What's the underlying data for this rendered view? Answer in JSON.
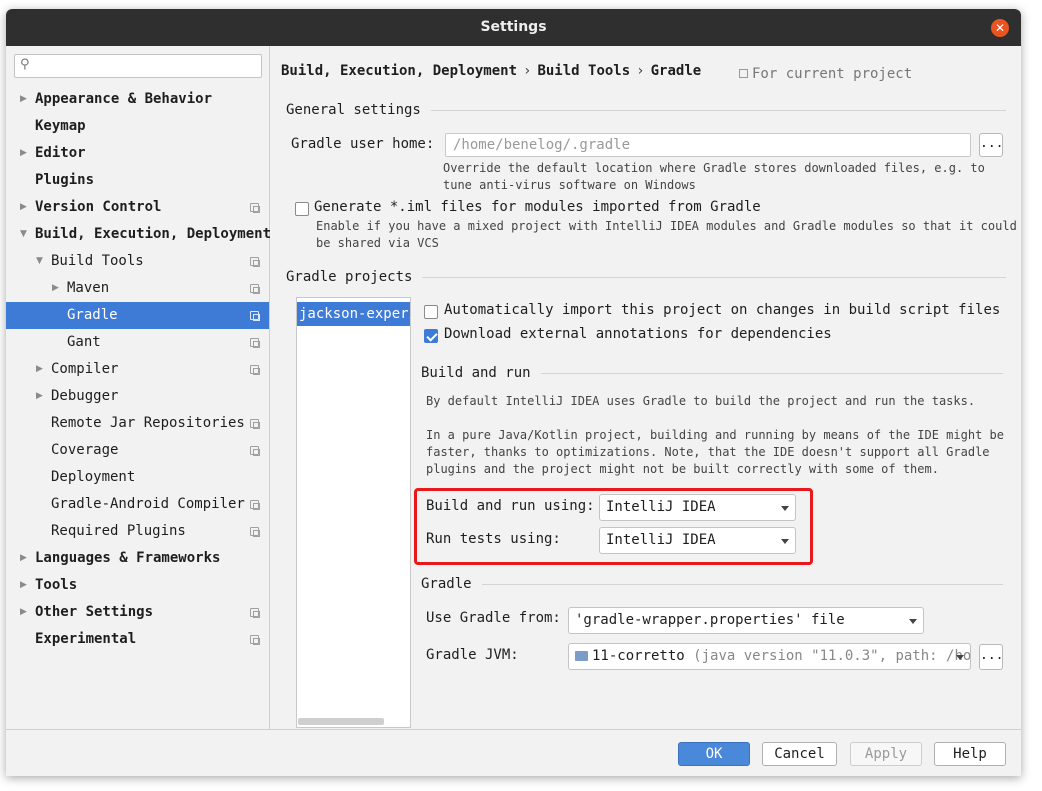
{
  "window": {
    "title": "Settings"
  },
  "search": {
    "placeholder": ""
  },
  "sidebar": {
    "items": [
      {
        "label": "Appearance & Behavior",
        "arrow": "▶",
        "bold": true
      },
      {
        "label": "Keymap",
        "bold": true
      },
      {
        "label": "Editor",
        "arrow": "▶",
        "bold": true
      },
      {
        "label": "Plugins",
        "bold": true
      },
      {
        "label": "Version Control",
        "arrow": "▶",
        "bold": true,
        "project_icon": true
      },
      {
        "label": "Build, Execution, Deployment",
        "arrow": "▼",
        "bold": true
      },
      {
        "label": "Build Tools",
        "arrow": "▼",
        "project_icon": true
      },
      {
        "label": "Maven",
        "arrow": "▶",
        "project_icon": true
      },
      {
        "label": "Gradle",
        "selected": true,
        "project_icon": true
      },
      {
        "label": "Gant",
        "project_icon": true
      },
      {
        "label": "Compiler",
        "arrow": "▶",
        "project_icon": true
      },
      {
        "label": "Debugger",
        "arrow": "▶"
      },
      {
        "label": "Remote Jar Repositories",
        "project_icon": true
      },
      {
        "label": "Coverage",
        "project_icon": true
      },
      {
        "label": "Deployment"
      },
      {
        "label": "Gradle-Android Compiler",
        "project_icon": true
      },
      {
        "label": "Required Plugins",
        "project_icon": true
      },
      {
        "label": "Languages & Frameworks",
        "arrow": "▶",
        "bold": true
      },
      {
        "label": "Tools",
        "arrow": "▶",
        "bold": true
      },
      {
        "label": "Other Settings",
        "arrow": "▶",
        "bold": true,
        "project_icon": true
      },
      {
        "label": "Experimental",
        "bold": true,
        "project_icon": true
      }
    ]
  },
  "breadcrumb": {
    "items": [
      "Build, Execution, Deployment",
      "Build Tools",
      "Gradle"
    ],
    "separator": "›",
    "for_current_project": "For current project"
  },
  "general": {
    "header": "General settings",
    "gradle_home_label": "Gradle user home:",
    "gradle_home_value": "/home/benelog/.gradle",
    "browse_label": "...",
    "gradle_home_hint_1": "Override the default location where Gradle stores downloaded files, e.g. to",
    "gradle_home_hint_2": "tune anti-virus software on Windows",
    "iml_label": "Generate *.iml files for modules imported from Gradle",
    "iml_checked": false,
    "iml_hint_1": "Enable if you have a mixed project with IntelliJ IDEA modules and Gradle modules so that it could",
    "iml_hint_2": "be shared via VCS"
  },
  "projects": {
    "header": "Gradle projects",
    "list": [
      "jackson-experiment"
    ],
    "auto_import_label": "Automatically import this project on changes in build script files",
    "auto_import_checked": false,
    "download_annotations_label": "Download external annotations for dependencies",
    "download_annotations_checked": true
  },
  "build_run": {
    "header": "Build and run",
    "desc_1": "By default IntelliJ IDEA uses Gradle to build the project and run the tasks.",
    "desc_2": "In a pure Java/Kotlin project, building and running by means of the IDE might be",
    "desc_3": "faster, thanks to optimizations. Note, that the IDE doesn't support all Gradle",
    "desc_4": "plugins and the project might not be built correctly with some of them.",
    "build_using_label": "Build and run using:",
    "build_using_value": "IntelliJ IDEA",
    "tests_using_label": "Run tests using:",
    "tests_using_value": "IntelliJ IDEA",
    "highlight_color": "#e8191a"
  },
  "gradle": {
    "header": "Gradle",
    "use_from_label": "Use Gradle from:",
    "use_from_value": "'gradle-wrapper.properties' file",
    "jvm_label": "Gradle JVM:",
    "jvm_name": "11-corretto",
    "jvm_detail": "(java version \"11.0.3\", path: /ho",
    "jvm_browse": "..."
  },
  "footer": {
    "ok": "OK",
    "cancel": "Cancel",
    "apply": "Apply",
    "help": "Help"
  },
  "colors": {
    "accent": "#3e7bd6",
    "titlebar": "#2f2f2f",
    "close": "#e95420"
  }
}
